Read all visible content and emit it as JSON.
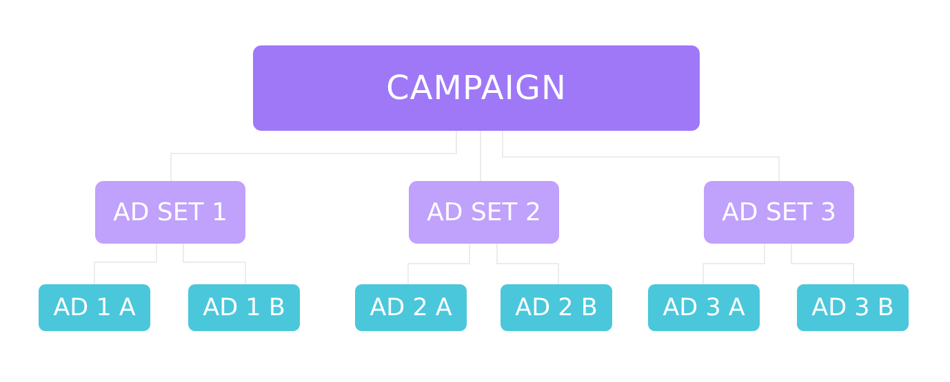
{
  "colors": {
    "campaign": "#9f78f8",
    "adset": "#c0a1fc",
    "ad": "#4ac7db",
    "connector": "#ececec"
  },
  "campaign": {
    "label": "CAMPAIGN"
  },
  "adsets": [
    {
      "label": "AD SET 1",
      "ads": [
        {
          "label": "AD 1 A"
        },
        {
          "label": "AD 1 B"
        }
      ]
    },
    {
      "label": "AD SET 2",
      "ads": [
        {
          "label": "AD 2 A"
        },
        {
          "label": "AD 2 B"
        }
      ]
    },
    {
      "label": "AD SET 3",
      "ads": [
        {
          "label": "AD 3 A"
        },
        {
          "label": "AD 3 B"
        }
      ]
    }
  ]
}
